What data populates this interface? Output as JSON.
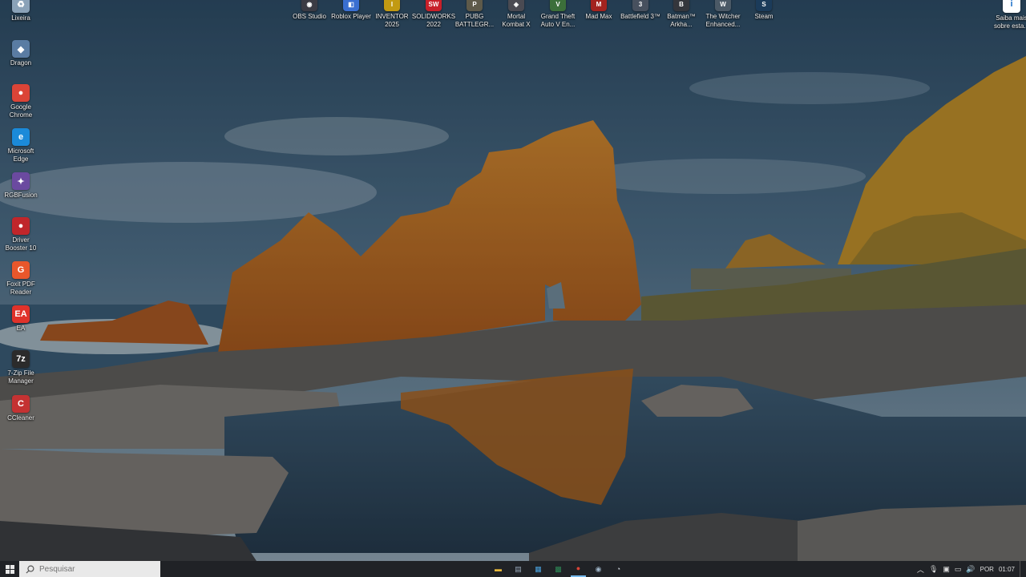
{
  "desktop": {
    "left_icons": [
      {
        "label": "Lixeira",
        "icon": "recycle-bin-icon",
        "color": "#8aa2b8",
        "glyph": "♻"
      },
      {
        "label": "Dragon",
        "icon": "dragon-icon",
        "color": "#5a7ca3",
        "glyph": "◆"
      },
      {
        "label": "Google\nChrome",
        "icon": "chrome-icon",
        "color": "#db4437",
        "glyph": "●"
      },
      {
        "label": "Microsoft\nEdge",
        "icon": "edge-icon",
        "color": "#1b8ad9",
        "glyph": "e"
      },
      {
        "label": "RGBFusion",
        "icon": "rgbfusion-icon",
        "color": "#6b4aa0",
        "glyph": "✦"
      },
      {
        "label": "Driver\nBooster 10",
        "icon": "driver-booster-icon",
        "color": "#c0262b",
        "glyph": "●"
      },
      {
        "label": "Foxit PDF\nReader",
        "icon": "foxit-icon",
        "color": "#e8572b",
        "glyph": "G"
      },
      {
        "label": "EA",
        "icon": "ea-icon",
        "color": "#e0322a",
        "glyph": "EA"
      },
      {
        "label": "7-Zip File\nManager",
        "icon": "7zip-icon",
        "color": "#2b2b2b",
        "glyph": "7z"
      },
      {
        "label": "CCleaner",
        "icon": "ccleaner-icon",
        "color": "#c43232",
        "glyph": "C"
      }
    ],
    "top_icons": [
      {
        "label": "OBS Studio",
        "icon": "obs-icon",
        "color": "#3b3b44",
        "glyph": "◉"
      },
      {
        "label": "Roblox Player",
        "icon": "roblox-icon",
        "color": "#3a6fd1",
        "glyph": "◧"
      },
      {
        "label": "INVENTOR\n2025",
        "icon": "inventor-icon",
        "color": "#c29a12",
        "glyph": "I"
      },
      {
        "label": "SOLIDWORKS\n2022",
        "icon": "solidworks-icon",
        "color": "#c8202a",
        "glyph": "SW"
      },
      {
        "label": "PUBG\nBATTLEGR...",
        "icon": "pubg-icon",
        "color": "#5e5a4a",
        "glyph": "P"
      },
      {
        "label": "Mortal\nKombat X",
        "icon": "mortal-kombat-icon",
        "color": "#4a4a52",
        "glyph": "◈"
      },
      {
        "label": "Grand Theft\nAuto V En...",
        "icon": "gta-icon",
        "color": "#3c6f3a",
        "glyph": "V"
      },
      {
        "label": "Mad Max",
        "icon": "mad-max-icon",
        "color": "#a3231f",
        "glyph": "M"
      },
      {
        "label": "Battlefield 3™",
        "icon": "battlefield-icon",
        "color": "#47505e",
        "glyph": "3"
      },
      {
        "label": "Batman™\nArkha...",
        "icon": "batman-icon",
        "color": "#34363c",
        "glyph": "B"
      },
      {
        "label": "The Witcher\nEnhanced...",
        "icon": "witcher-icon",
        "color": "#4b5966",
        "glyph": "W"
      },
      {
        "label": "Steam",
        "icon": "steam-icon",
        "color": "#1b3b5a",
        "glyph": "S"
      }
    ],
    "right_icon": {
      "label": "Saiba mais\nsobre esta...",
      "icon": "learn-more-icon",
      "color": "#ffffff",
      "glyph": "i"
    }
  },
  "taskbar": {
    "search_placeholder": "Pesquisar",
    "pinned": [
      {
        "icon": "file-explorer-icon",
        "glyph": "▬",
        "color": "#e8b83a"
      },
      {
        "icon": "notepad-icon",
        "glyph": "▤",
        "color": "#9ab"
      },
      {
        "icon": "store-icon",
        "glyph": "▦",
        "color": "#4aa3df"
      },
      {
        "icon": "excel-icon",
        "glyph": "▩",
        "color": "#2e8b57"
      },
      {
        "icon": "chrome-taskbar-icon",
        "glyph": "●",
        "color": "#db4437"
      },
      {
        "icon": "steam-taskbar-icon",
        "glyph": "◉",
        "color": "#9fb5c8"
      },
      {
        "icon": "clock-app-icon",
        "glyph": "◔",
        "color": "#cfd6de"
      }
    ],
    "tray": {
      "language": "POR",
      "time": "01:07"
    }
  }
}
